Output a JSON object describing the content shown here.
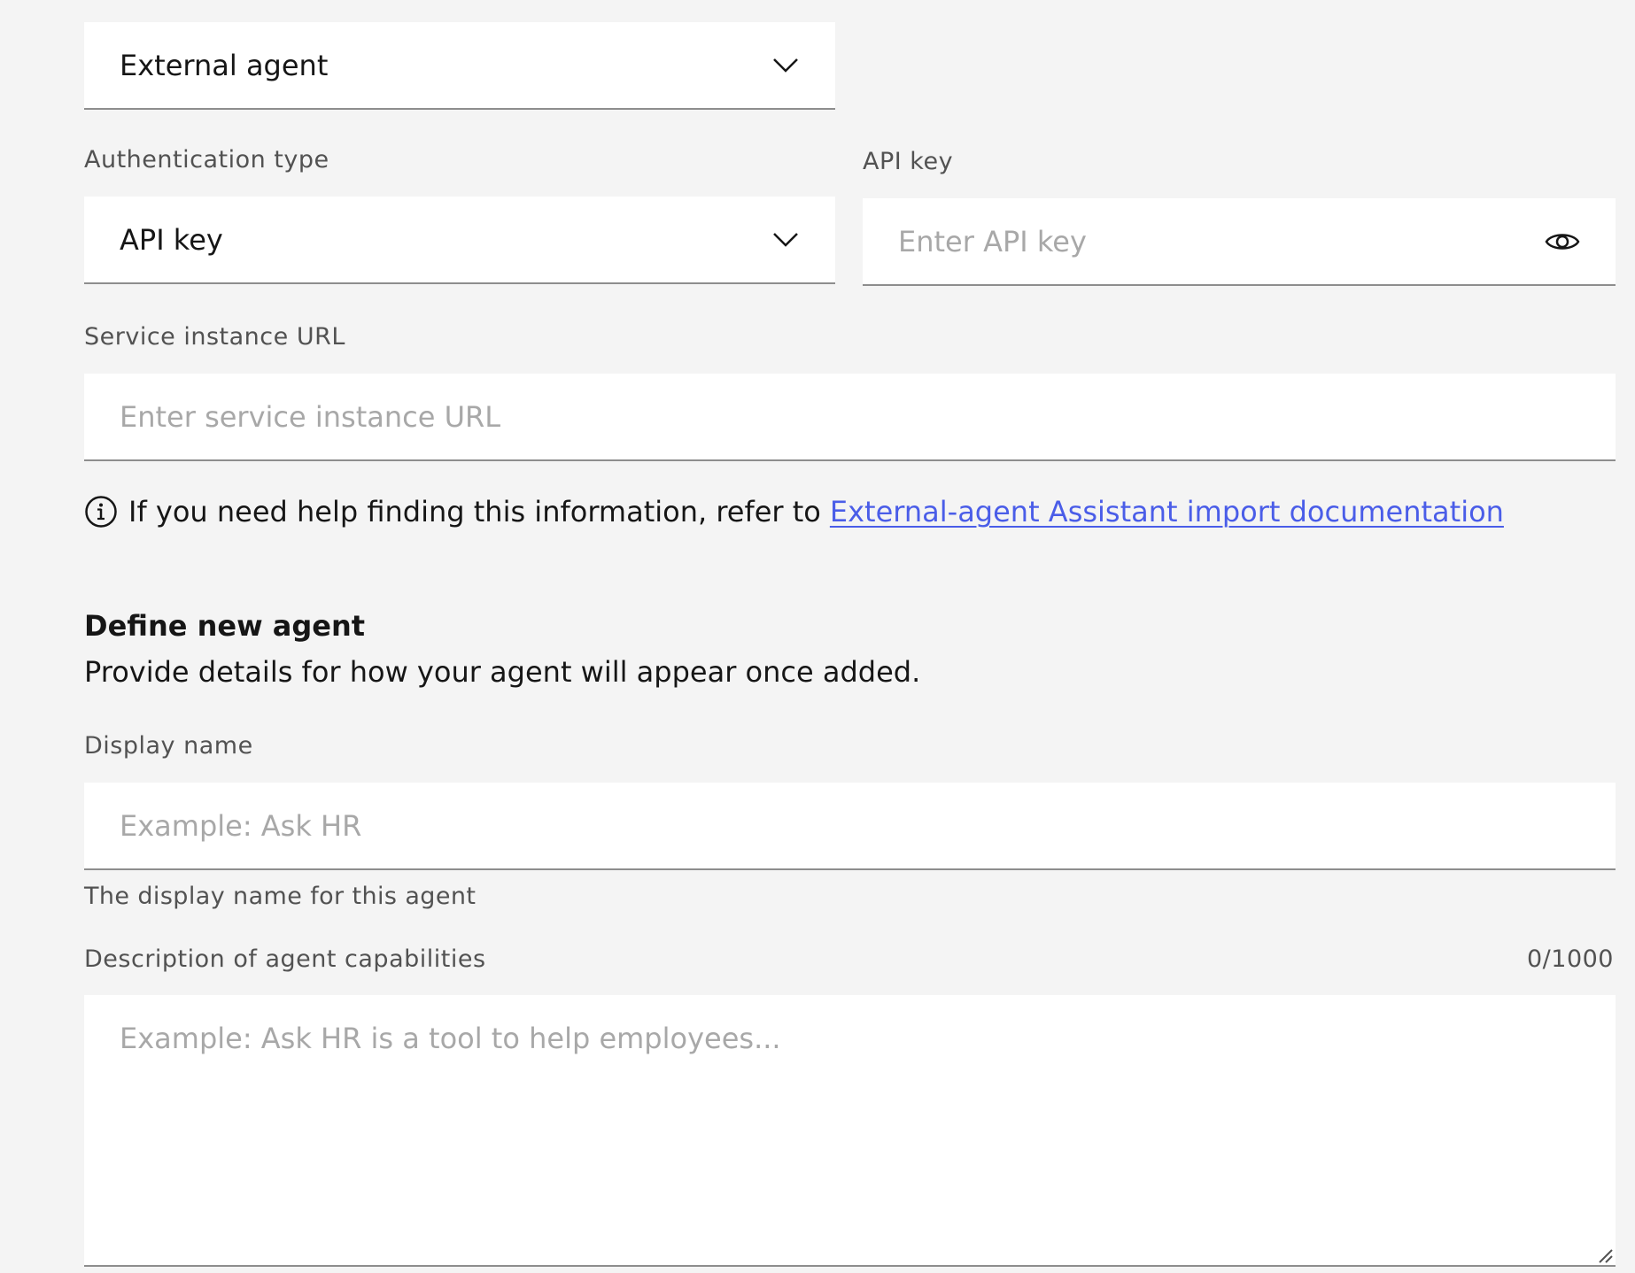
{
  "agent_source": {
    "selected": "External agent",
    "icon": "chevron-down-icon"
  },
  "authentication": {
    "label": "Authentication type",
    "selected": "API key",
    "icon": "chevron-down-icon"
  },
  "api_key": {
    "label": "API key",
    "placeholder": "Enter API key",
    "value": "",
    "icon": "eye-icon"
  },
  "service_url": {
    "label": "Service instance URL",
    "placeholder": "Enter service instance URL",
    "value": ""
  },
  "help": {
    "icon": "info-icon",
    "text": "If you need help finding this information, refer to",
    "link_text": "External-agent Assistant import documentation",
    "link_color": "#4a5de8"
  },
  "define_agent": {
    "title": "Define new agent",
    "subtitle": "Provide details for how your agent will appear once added."
  },
  "display_name": {
    "label": "Display name",
    "placeholder": "Example: Ask HR",
    "value": "",
    "helper": "The display name for this agent"
  },
  "description": {
    "label": "Description of agent capabilities",
    "counter": "0/1000",
    "placeholder": "Example: Ask HR is a tool to help employees...",
    "value": "",
    "resize_icon": "resize-handle-icon"
  }
}
